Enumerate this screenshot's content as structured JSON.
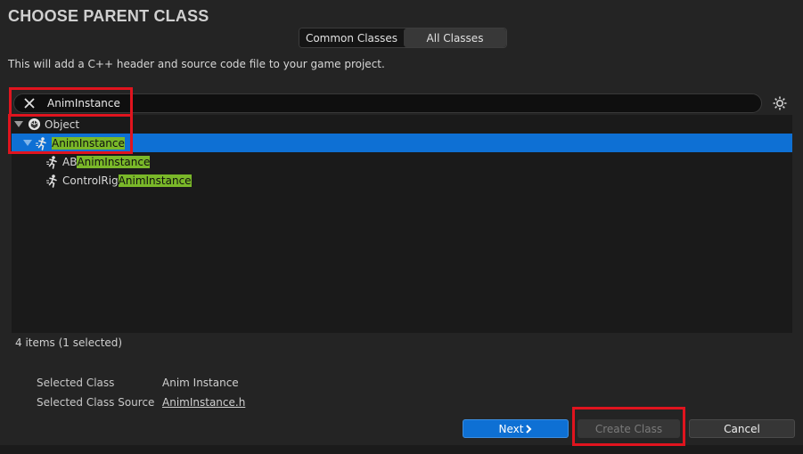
{
  "dialog": {
    "title": "CHOOSE PARENT CLASS",
    "description": "This will add a C++ header and source code file to your game project."
  },
  "mode_toggle": {
    "common_label": "Common Classes",
    "all_label": "All Classes",
    "selected": "All Classes"
  },
  "search": {
    "value": "AnimInstance",
    "clear_icon": "close-icon"
  },
  "settings_icon": "gear-icon",
  "tree": {
    "rows": [
      {
        "prefix": "Object",
        "match": "",
        "suffix": "",
        "icon": "object-class-icon",
        "expanded": true,
        "selected": false
      },
      {
        "prefix": "",
        "match": "AnimInstance",
        "suffix": "",
        "icon": "anim-class-icon",
        "expanded": true,
        "selected": true
      },
      {
        "prefix": "AB",
        "match": "AnimInstance",
        "suffix": "",
        "icon": "anim-class-icon",
        "expanded": false,
        "selected": false
      },
      {
        "prefix": "ControlRig",
        "match": "AnimInstance",
        "suffix": "",
        "icon": "anim-class-icon",
        "expanded": false,
        "selected": false
      }
    ]
  },
  "status": "4 items (1 selected)",
  "details": {
    "selected_class_label": "Selected Class",
    "selected_class_value": "Anim Instance",
    "selected_source_label": "Selected Class Source",
    "selected_source_value": "AnimInstance.h"
  },
  "buttons": {
    "next": "Next",
    "create": "Create Class",
    "cancel": "Cancel"
  },
  "colors": {
    "accent": "#0e70d4",
    "highlight": "#7ab829",
    "annotation": "#e0141e"
  }
}
